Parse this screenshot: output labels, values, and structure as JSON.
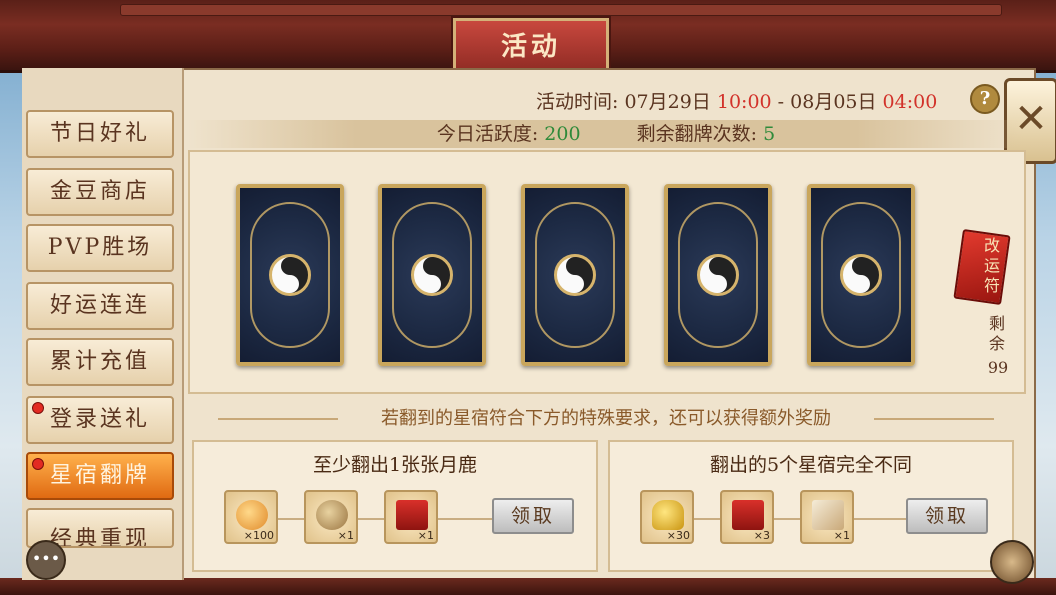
{
  "window": {
    "title": "活动"
  },
  "sidebar": {
    "items": [
      {
        "label": "节日好礼",
        "active": false,
        "badge": false
      },
      {
        "label": "金豆商店",
        "active": false,
        "badge": false
      },
      {
        "label": "PVP胜场",
        "active": false,
        "badge": false
      },
      {
        "label": "好运连连",
        "active": false,
        "badge": false
      },
      {
        "label": "累计充值",
        "active": false,
        "badge": false
      },
      {
        "label": "登录送礼",
        "active": false,
        "badge": true
      },
      {
        "label": "星宿翻牌",
        "active": true,
        "badge": true
      },
      {
        "label": "经典重现",
        "active": false,
        "badge": false
      }
    ]
  },
  "header": {
    "time_label": "活动时间:",
    "start_date": "07月29日",
    "start_time": "10:00",
    "separator": "-",
    "end_date": "08月05日",
    "end_time": "04:00",
    "help_symbol": "?",
    "close_symbol": "✕"
  },
  "stats": {
    "activity_label": "今日活跃度:",
    "activity_value": "200",
    "flips_label": "剩余翻牌次数:",
    "flips_value": "5"
  },
  "cards": {
    "count": 5,
    "face": "yin-yang-card-back"
  },
  "luck_charm": {
    "name": "改运符",
    "remain_label": "剩余",
    "remain_count": "99"
  },
  "hint": "若翻到的星宿符合下方的特殊要求，还可以获得额外奖励",
  "tasks": [
    {
      "title": "至少翻出1张张月鹿",
      "rewards": [
        {
          "icon": "fruit-icon",
          "count": "×100"
        },
        {
          "icon": "seed-bag-icon",
          "count": "×1"
        },
        {
          "icon": "red-chest-icon",
          "count": "×1"
        }
      ],
      "button": "领取"
    },
    {
      "title": "翻出的5个星宿完全不同",
      "rewards": [
        {
          "icon": "gold-ingot-icon",
          "count": "×30"
        },
        {
          "icon": "red-chest-icon",
          "count": "×3"
        },
        {
          "icon": "scroll-icon",
          "count": "×1"
        }
      ],
      "button": "领取"
    }
  ],
  "colors": {
    "accent_red": "#d2322a",
    "accent_green": "#2f8a3a",
    "active_tab": "#e06a12"
  }
}
